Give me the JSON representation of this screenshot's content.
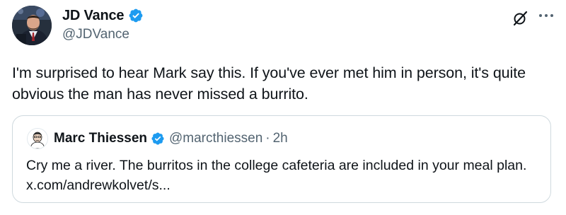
{
  "tweet": {
    "author": {
      "display_name": "JD Vance",
      "handle": "@JDVance",
      "verified": true,
      "avatar_icon": "jd-vance-avatar"
    },
    "text": "I'm surprised to hear Mark say this. If you've ever met him in person, it's quite obvious the man has never missed a burrito.",
    "actions": {
      "grok_icon": "grok-icon",
      "more_icon": "more-options-icon"
    },
    "quote": {
      "author": {
        "display_name": "Marc Thiessen",
        "handle": "@marcthiessen",
        "verified": true,
        "avatar_icon": "marc-thiessen-avatar"
      },
      "separator": "·",
      "time": "2h",
      "text": "Cry me a river. The burritos in the college cafeteria are included in your meal plan. x.com/andrewkolvet/s..."
    }
  },
  "colors": {
    "text_primary": "#0f1419",
    "text_secondary": "#536471",
    "verified_blue": "#1d9bf0",
    "border": "#cfd9de"
  }
}
